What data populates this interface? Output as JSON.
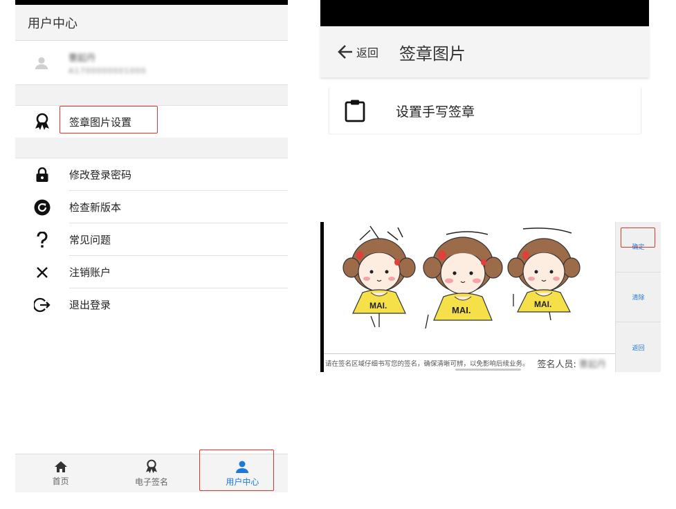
{
  "left": {
    "header_title": "用户中心",
    "user": {
      "name": "曹起丹",
      "id": "A1700000001000"
    },
    "menu": [
      {
        "label": "签章图片设置",
        "icon": "ribbon-badge-icon"
      },
      {
        "label": "修改登录密码",
        "icon": "lock-icon"
      },
      {
        "label": "检查新版本",
        "icon": "refresh-icon"
      },
      {
        "label": "常见问题",
        "icon": "question-icon"
      },
      {
        "label": "注销账户",
        "icon": "close-icon"
      },
      {
        "label": "退出登录",
        "icon": "logout-icon"
      }
    ],
    "tabs": [
      {
        "label": "首页",
        "icon": "home-icon"
      },
      {
        "label": "电子签名",
        "icon": "ribbon-badge-icon"
      },
      {
        "label": "用户中心",
        "icon": "person-icon"
      }
    ],
    "active_tab": "用户中心"
  },
  "top_right": {
    "back_label": "返回",
    "title": "签章图片",
    "card_label": "设置手写签章"
  },
  "bottom_right": {
    "figure_text": "MAI.",
    "hint": "请在签名区域仔细书写您的签名，确保清晰可辨，以免影响后续业务。",
    "signer_label": "签名人员:",
    "signer_name": "曹起丹",
    "buttons": {
      "confirm": "确定",
      "clear": "清除",
      "back": "返回"
    }
  },
  "colors": {
    "accent": "#1e78d8",
    "highlight": "#e0352b",
    "shirt": "#f5e04a",
    "hair": "#9b6b4a"
  }
}
